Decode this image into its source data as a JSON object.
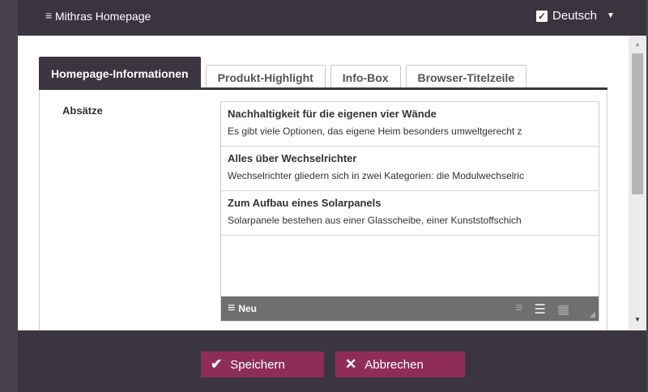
{
  "window": {
    "title": "Mithras Homepage",
    "menu_icon": "hamburger-icon",
    "language": {
      "label": "Deutsch",
      "checked": true
    }
  },
  "tabs": [
    {
      "label": "Homepage-Informationen",
      "active": true
    },
    {
      "label": "Produkt-Highlight",
      "active": false
    },
    {
      "label": "Info-Box",
      "active": false
    },
    {
      "label": "Browser-Titelzeile",
      "active": false
    }
  ],
  "field": {
    "label": "Absätze",
    "items": [
      {
        "title": "Nachhaltigkeit für die eigenen vier Wände",
        "text": "Es gibt viele Optionen, das eigene Heim besonders umweltgerecht z"
      },
      {
        "title": "Alles über Wechselrichter",
        "text": "Wechselrichter gliedern sich in zwei Kategorien: die Modulwechselric"
      },
      {
        "title": "Zum Aufbau eines Solarpanels",
        "text": "Solarpanele bestehen aus einer Glasscheibe, einer Kunststoffschich"
      }
    ],
    "toolbar": {
      "new_label": "Neu"
    }
  },
  "buttons": {
    "save": "Speichern",
    "cancel": "Abbrechen"
  },
  "colors": {
    "accent": "#8e2e57",
    "chrome": "#3b353f"
  }
}
